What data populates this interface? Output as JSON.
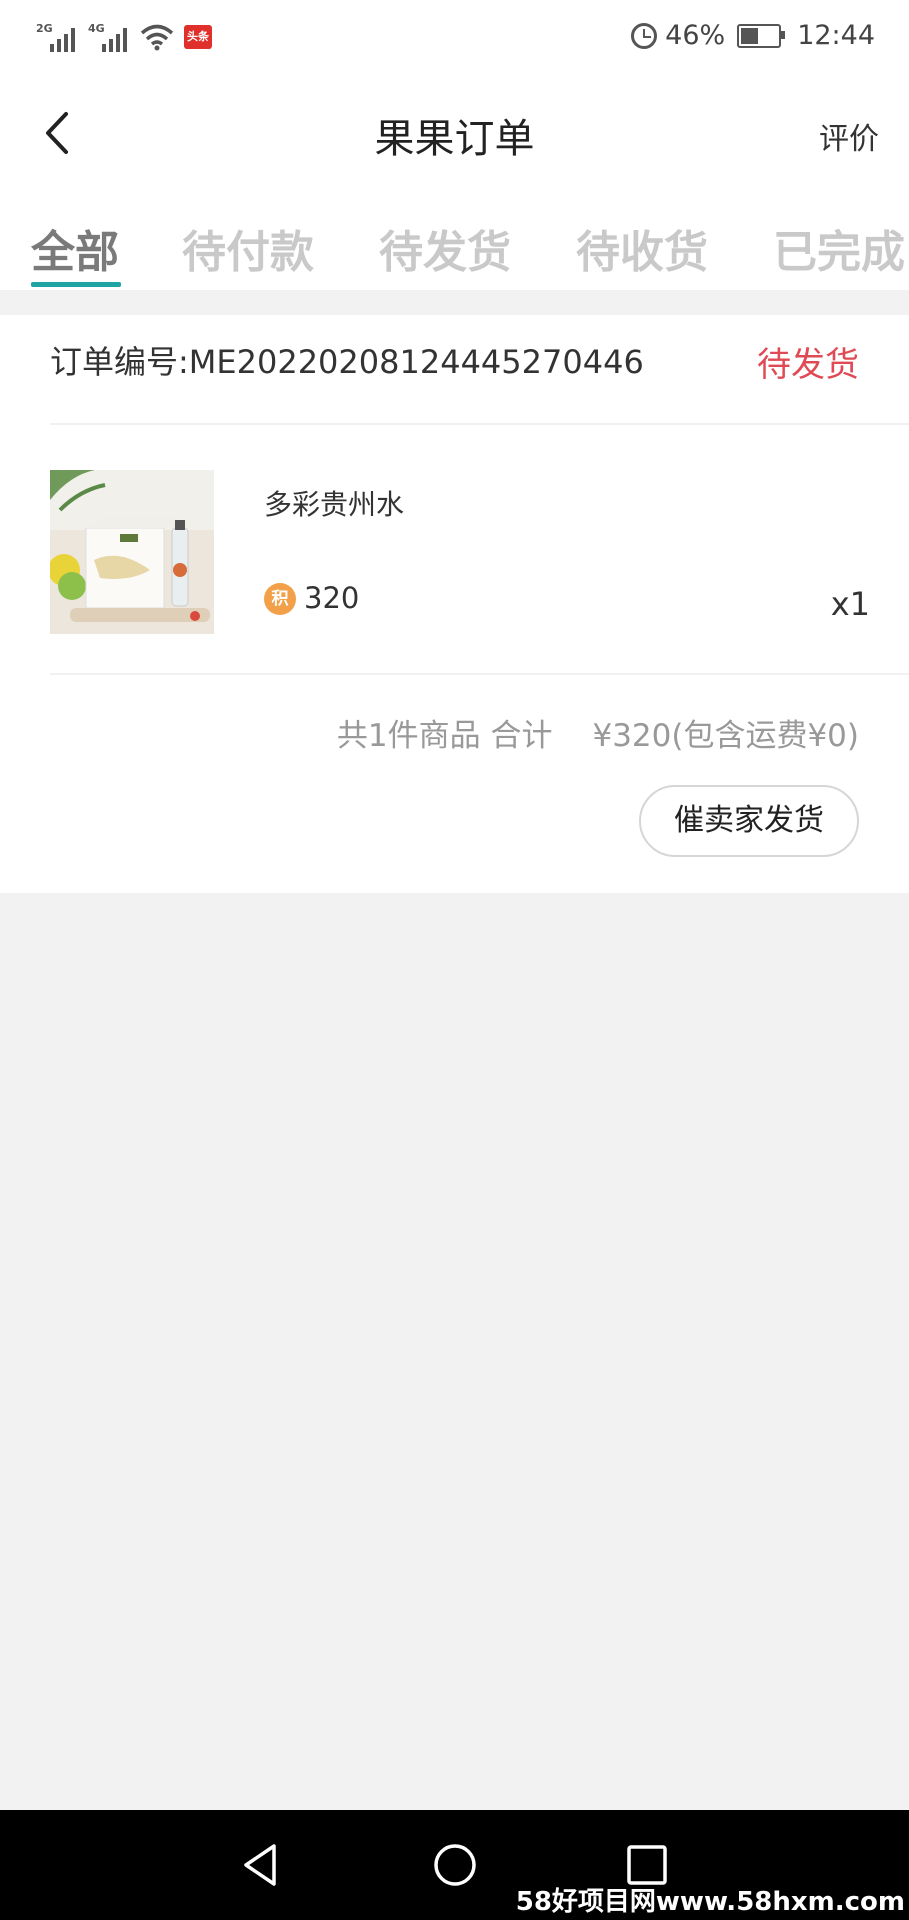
{
  "status_bar": {
    "signal1_label": "2G",
    "signal2_label": "4G",
    "news_app_label": "头条",
    "battery_percent": "46%",
    "battery_level": 0.46,
    "time": "12:44"
  },
  "nav": {
    "title": "果果订单",
    "right_action": "评价"
  },
  "tabs": [
    {
      "label": "全部",
      "active": true
    },
    {
      "label": "待付款",
      "active": false
    },
    {
      "label": "待发货",
      "active": false
    },
    {
      "label": "待收货",
      "active": false
    },
    {
      "label": "已完成",
      "active": false
    }
  ],
  "order": {
    "order_number": "订单编号:ME20220208124445270446",
    "status": "待发货",
    "product_name": "多彩贵州水",
    "points_icon_text": "积",
    "points": "320",
    "quantity": "x1",
    "summary_count": "共1件商品 合计",
    "summary_total": "¥320(包含运费¥0)",
    "action_button": "催卖家发货"
  },
  "colors": {
    "accent": "#1fa3a4",
    "status_red": "#e04a55",
    "points_orange": "#f2a14a"
  },
  "watermark": "58好项目网www.58hxm.com"
}
